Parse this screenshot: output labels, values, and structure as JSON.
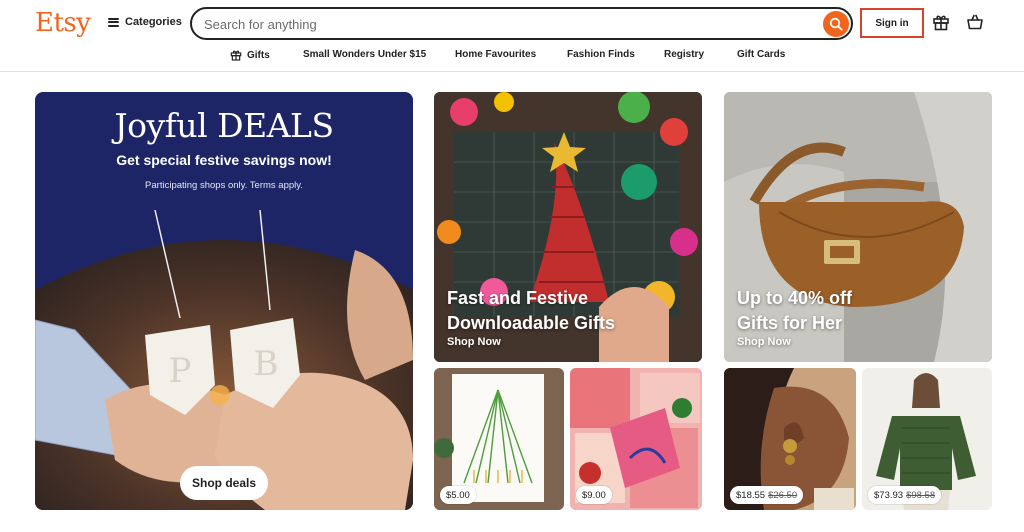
{
  "header": {
    "logo": "Etsy",
    "categories_label": "Categories",
    "search_placeholder": "Search for anything",
    "signin_label": "Sign in"
  },
  "nav": {
    "items": [
      "Gifts",
      "Small Wonders Under $15",
      "Home Favourites",
      "Fashion Finds",
      "Registry",
      "Gift Cards"
    ]
  },
  "hero": {
    "title": "Joyful DEALS",
    "subtitle": "Get special festive savings now!",
    "note": "Participating shops only. Terms apply.",
    "button_label": "Shop deals",
    "ornament_letters": [
      "P",
      "B"
    ]
  },
  "promos": [
    {
      "title_line1": "Fast and Festive",
      "title_line2": "Downloadable Gifts",
      "link": "Shop Now"
    },
    {
      "title_line1": "Up to 40% off",
      "title_line2": "Gifts for Her",
      "link": "Shop Now"
    }
  ],
  "products": [
    {
      "price": "$5.00",
      "original_price": ""
    },
    {
      "price": "$9.00",
      "original_price": ""
    },
    {
      "price": "$18.55",
      "original_price": "$26.50"
    },
    {
      "price": "$73.93",
      "original_price": "$98.58"
    }
  ],
  "colors": {
    "brand": "#f1641e",
    "hero_bg": "#1d2566",
    "signin_outline": "#d8432b"
  }
}
